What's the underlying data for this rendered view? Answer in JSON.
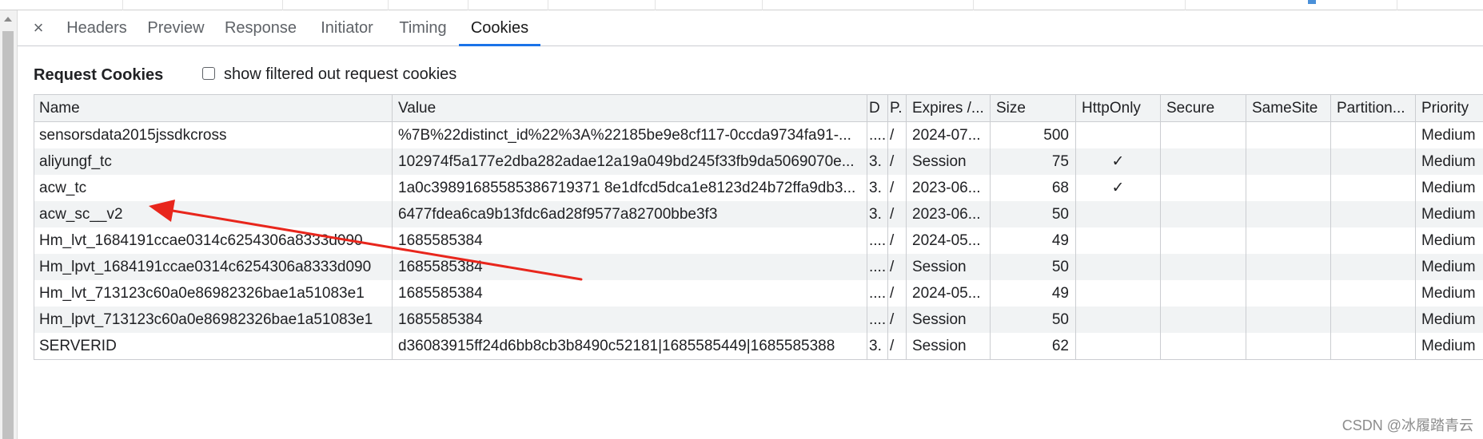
{
  "tabs": {
    "close_glyph": "×",
    "items": [
      "Headers",
      "Preview",
      "Response",
      "Initiator",
      "Timing",
      "Cookies"
    ],
    "active": "Cookies"
  },
  "section": {
    "title": "Request Cookies",
    "filter_label": "show filtered out request cookies",
    "filter_checked": false
  },
  "table": {
    "columns": [
      "Name",
      "Value",
      "D",
      "P.",
      "Expires /...",
      "Size",
      "HttpOnly",
      "Secure",
      "SameSite",
      "Partition...",
      "Priority"
    ],
    "rows": [
      [
        "sensorsdata2015jssdkcross",
        "%7B%22distinct_id%22%3A%22185be9e8cf117-0ccda9734fa91-...",
        "....",
        "/",
        "2024-07...",
        "500",
        "",
        "",
        "",
        "",
        "Medium"
      ],
      [
        "aliyungf_tc",
        "102974f5a177e2dba282adae12a19a049bd245f33fb9da5069070e...",
        "3.",
        "/",
        "Session",
        "75",
        "✓",
        "",
        "",
        "",
        "Medium"
      ],
      [
        "acw_tc",
        "1a0c39891685585386719371 8e1dfcd5dca1e8123d24b72ffa9db3...",
        "3.",
        "/",
        "2023-06...",
        "68",
        "✓",
        "",
        "",
        "",
        "Medium"
      ],
      [
        "acw_sc__v2",
        "6477fdea6ca9b13fdc6ad28f9577a82700bbe3f3",
        "3.",
        "/",
        "2023-06...",
        "50",
        "",
        "",
        "",
        "",
        "Medium"
      ],
      [
        "Hm_lvt_1684191ccae0314c6254306a8333d090",
        "1685585384",
        "....",
        "/",
        "2024-05...",
        "49",
        "",
        "",
        "",
        "",
        "Medium"
      ],
      [
        "Hm_lpvt_1684191ccae0314c6254306a8333d090",
        "1685585384",
        "....",
        "/",
        "Session",
        "50",
        "",
        "",
        "",
        "",
        "Medium"
      ],
      [
        "Hm_lvt_713123c60a0e86982326bae1a51083e1",
        "1685585384",
        "....",
        "/",
        "2024-05...",
        "49",
        "",
        "",
        "",
        "",
        "Medium"
      ],
      [
        "Hm_lpvt_713123c60a0e86982326bae1a51083e1",
        "1685585384",
        "....",
        "/",
        "Session",
        "50",
        "",
        "",
        "",
        "",
        "Medium"
      ],
      [
        "SERVERID",
        "d36083915ff24d6bb8cb3b8490c52181|1685585449|1685585388",
        "3.",
        "/",
        "Session",
        "62",
        "",
        "",
        "",
        "",
        "Medium"
      ]
    ]
  },
  "watermark": "CSDN @冰履踏青云",
  "colors": {
    "accent": "#1a73e8",
    "annotation_arrow": "#e8261c",
    "row_alt": "#f1f3f4"
  },
  "icons": {
    "close": "close-icon",
    "checkbox": "checkbox-icon",
    "check": "checkmark-icon"
  }
}
